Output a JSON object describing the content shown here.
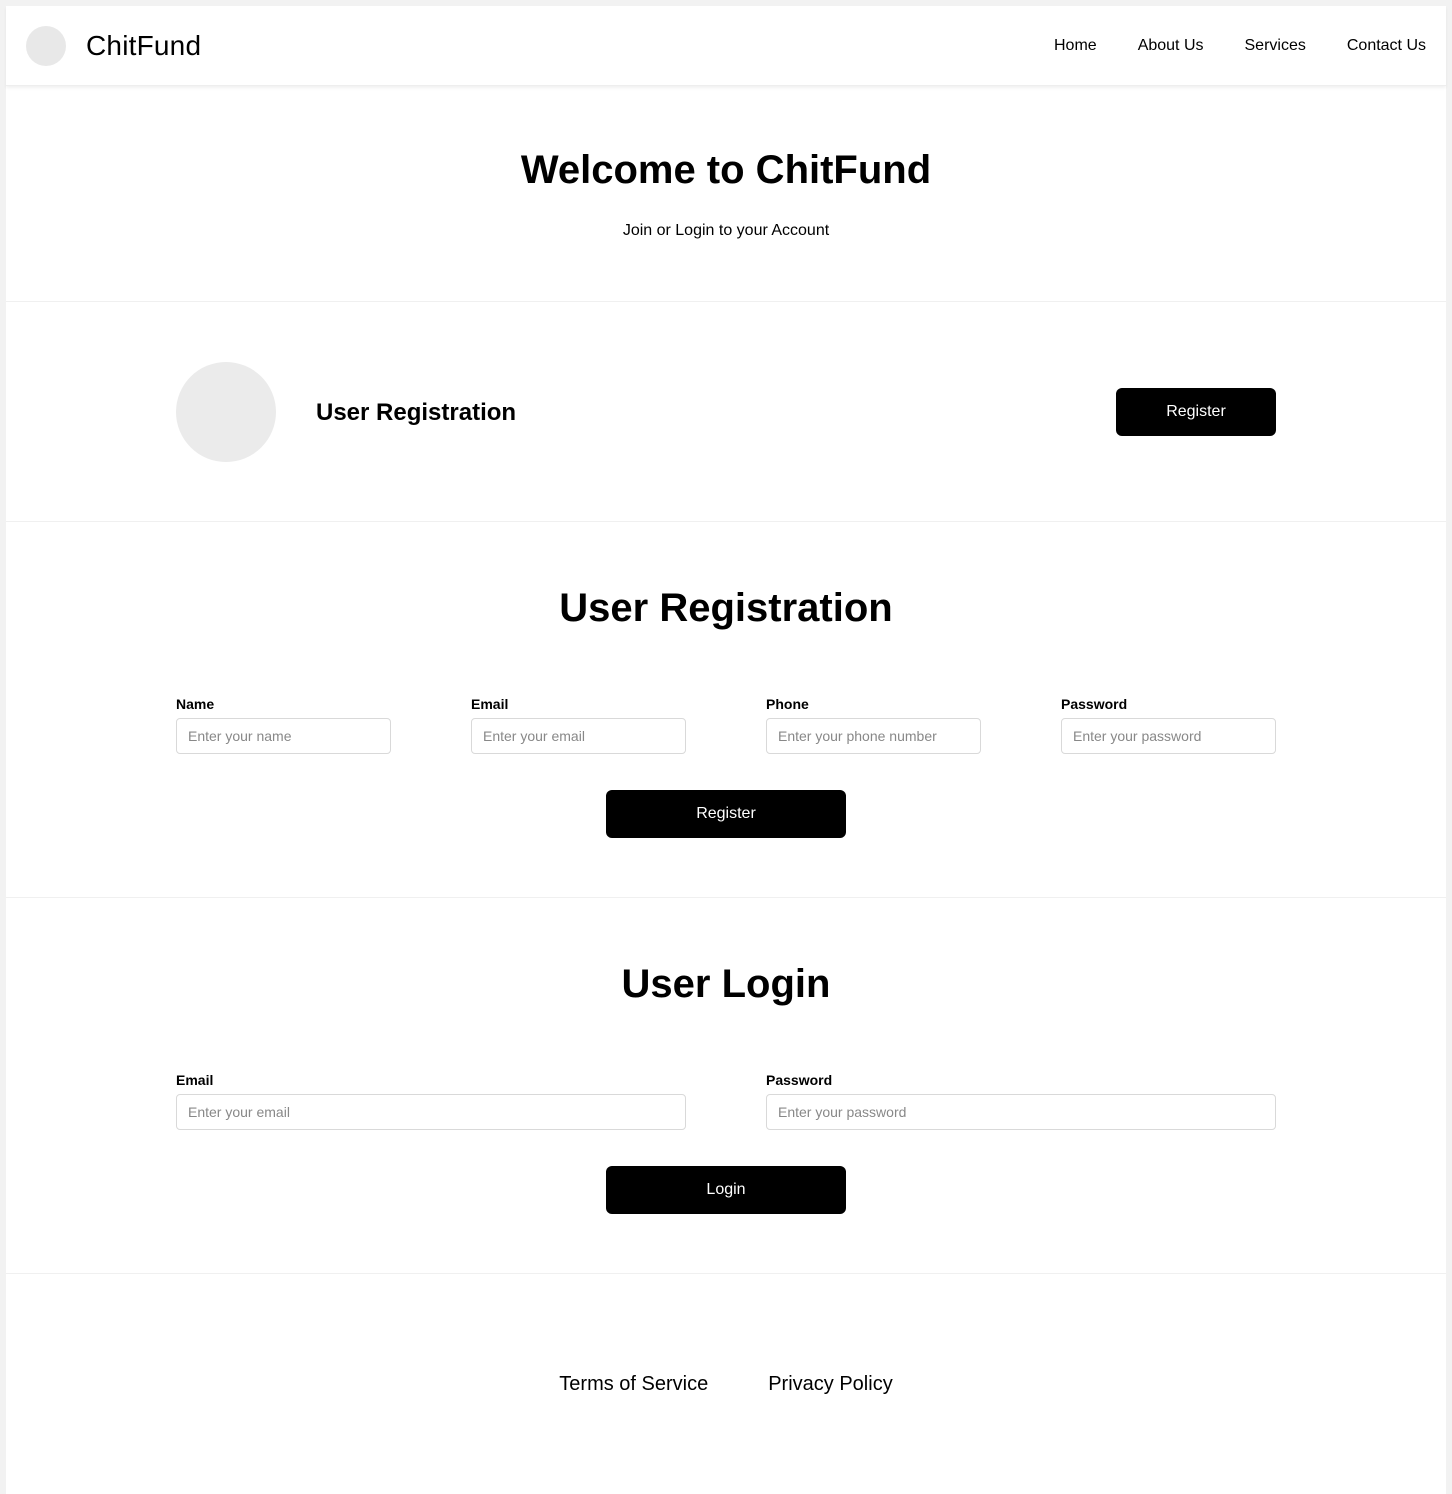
{
  "header": {
    "brand": "ChitFund",
    "nav": [
      "Home",
      "About Us",
      "Services",
      "Contact Us"
    ]
  },
  "hero": {
    "title": "Welcome to ChitFund",
    "subtitle": "Join or Login to your Account"
  },
  "banner": {
    "title": "User Registration",
    "button_label": "Register"
  },
  "registration": {
    "title": "User Registration",
    "fields": [
      {
        "label": "Name",
        "placeholder": "Enter your name",
        "value": ""
      },
      {
        "label": "Email",
        "placeholder": "Enter your email",
        "value": ""
      },
      {
        "label": "Phone",
        "placeholder": "Enter your phone number",
        "value": ""
      },
      {
        "label": "Password",
        "placeholder": "Enter your password",
        "value": ""
      }
    ],
    "submit_label": "Register"
  },
  "login": {
    "title": "User Login",
    "fields": [
      {
        "label": "Email",
        "placeholder": "Enter your email",
        "value": ""
      },
      {
        "label": "Password",
        "placeholder": "Enter your password",
        "value": ""
      }
    ],
    "submit_label": "Login"
  },
  "footer": {
    "links": [
      "Terms of Service",
      "Privacy Policy"
    ]
  },
  "colors": {
    "primary_button": "#000000",
    "button_text": "#ffffff",
    "placeholder_circle": "#e8e8e8"
  }
}
